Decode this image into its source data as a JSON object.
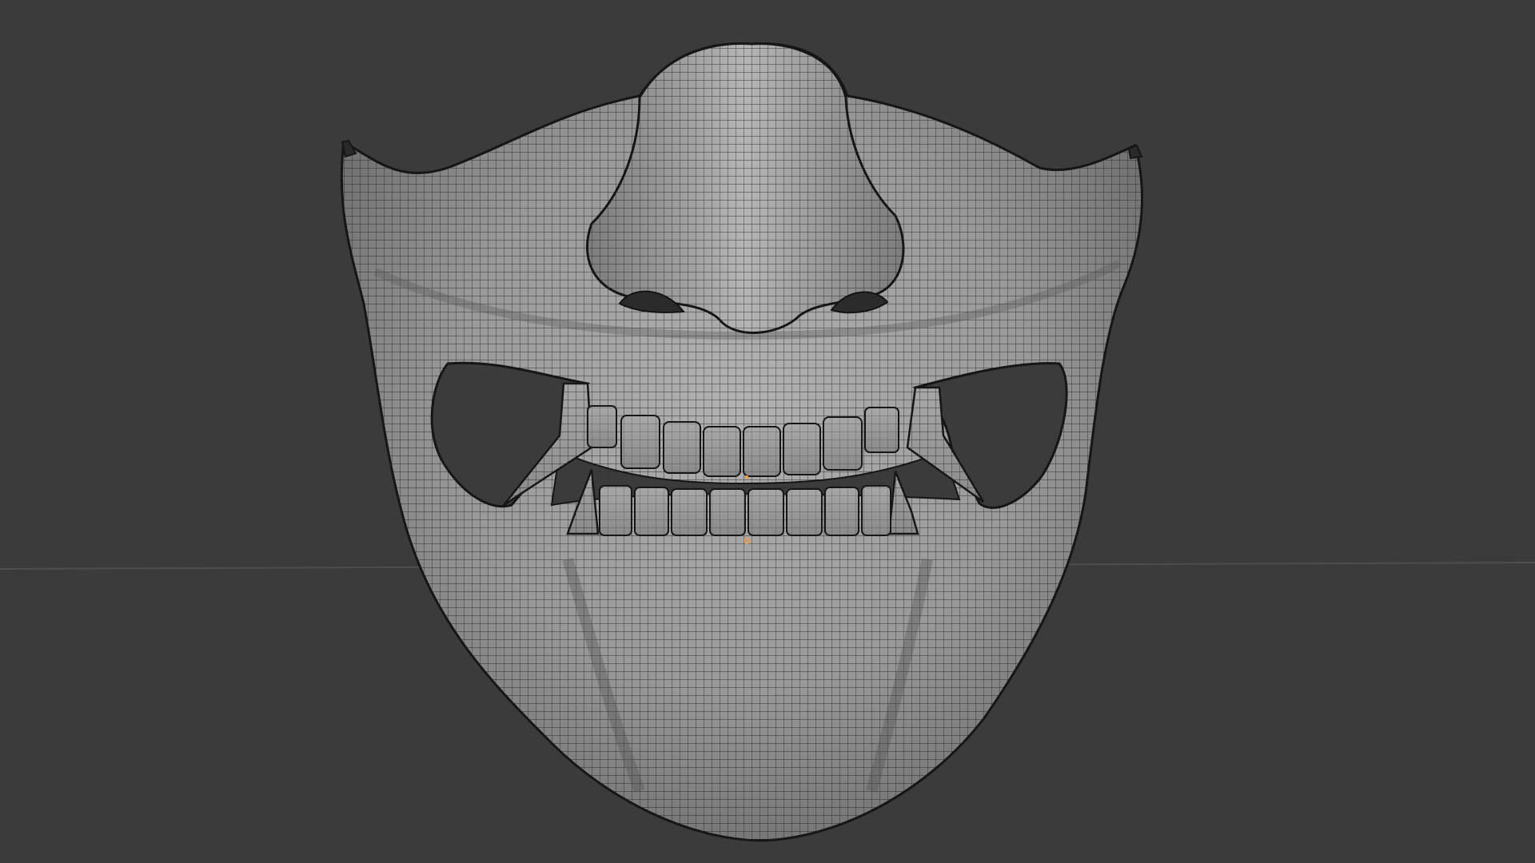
{
  "viewport": {
    "background": "#3b3b3b",
    "grid_floor_line": true,
    "object": "samurai-mask-wireframe",
    "shading": "solid-with-wireframe",
    "mesh_color": "#9a9a9a",
    "wire_color": "#1c1c1c",
    "origin_marker_color": "#ff9a2e"
  }
}
